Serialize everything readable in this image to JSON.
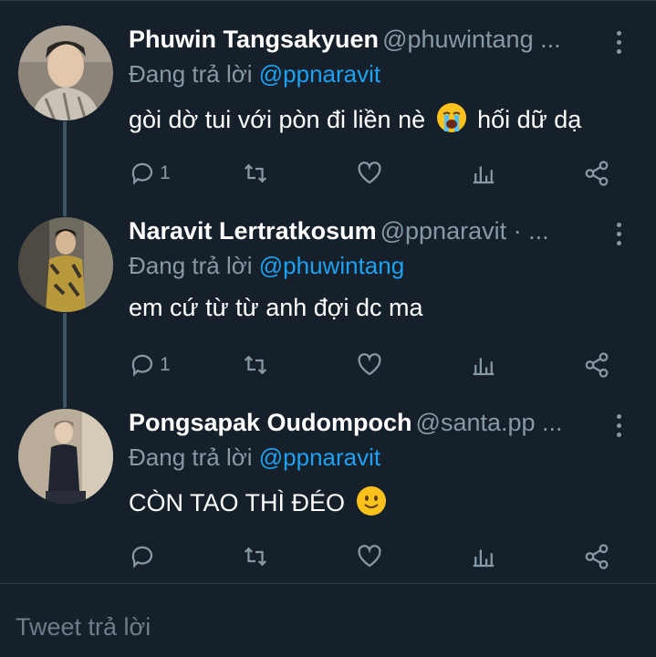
{
  "thread": {
    "tweets": [
      {
        "name": "Phuwin Tangsakyuen",
        "handle": "@phuwintang ...",
        "replying_prefix": "Đang trả lời ",
        "replying_to": "@ppnaravit",
        "text_before": "gòi dờ tui với pòn đi liền nè ",
        "emoji": "loudly-crying-face",
        "text_after": " hối dữ dạ",
        "reply_count": "1",
        "avatar_colors": [
          "#c9b9a4",
          "#2a2623"
        ]
      },
      {
        "name": "Naravit Lertratkosum",
        "handle": "@ppnaravit · ...",
        "replying_prefix": "Đang trả lời ",
        "replying_to": "@phuwintang",
        "text_before": "em cứ từ từ anh đợi dc ma",
        "reply_count": "1",
        "avatar_colors": [
          "#b89a3c",
          "#3a3328"
        ]
      },
      {
        "name": "Pongsapak Oudompoch",
        "handle": "@santa.pp ...",
        "replying_prefix": "Đang trả lời ",
        "replying_to": "@ppnaravit",
        "text_before": "CÒN TAO THÌ ĐÉO ",
        "emoji": "slightly-smiling-face",
        "reply_count": "",
        "avatar_colors": [
          "#c8b89e",
          "#1f2430"
        ]
      }
    ]
  },
  "composer": {
    "placeholder": "Tweet trả lời"
  },
  "colors": {
    "background": "#15202b",
    "muted": "#8899a6",
    "accent": "#1da1f2",
    "thread_line": "#3d5466"
  },
  "icons": [
    "reply-icon",
    "retweet-icon",
    "like-icon",
    "analytics-icon",
    "share-icon",
    "more-icon"
  ]
}
